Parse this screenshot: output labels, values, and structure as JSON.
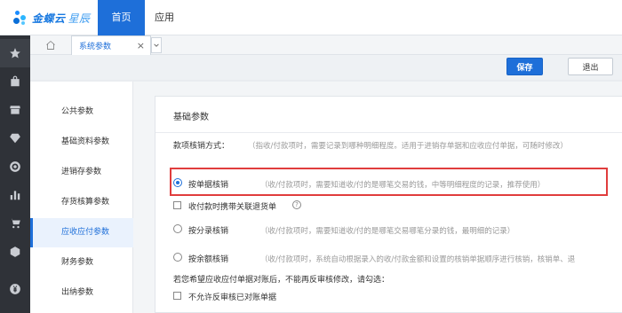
{
  "brand": {
    "name": "金蝶云",
    "product": "星辰"
  },
  "topnav": {
    "home": "首页",
    "apps": "应用"
  },
  "rail": {
    "items": [
      "star-icon",
      "bag-icon",
      "store-icon",
      "diamond-icon",
      "target-icon",
      "chart-icon",
      "cart-icon",
      "box-icon",
      "yen-icon"
    ]
  },
  "tabs": {
    "current": "系统参数",
    "close": "×"
  },
  "toolbar": {
    "save_label": "保存",
    "exit_label": "退出"
  },
  "sidebar": {
    "items": [
      {
        "label": "公共参数"
      },
      {
        "label": "基础资料参数"
      },
      {
        "label": "进销存参数"
      },
      {
        "label": "存货核算参数"
      },
      {
        "label": "应收应付参数"
      },
      {
        "label": "财务参数"
      },
      {
        "label": "出纳参数"
      }
    ],
    "active_index": 4
  },
  "panel": {
    "title": "基础参数",
    "method_label": "款项核销方式：",
    "method_hint": "（指收/付款项时，需要记录到哪种明细程度。适用于进销存单据和应收应付单据，可随时修改）",
    "options": [
      {
        "label": "按单据核销",
        "hint": "（收/付款项时，需要知道收/付的是哪笔交易的钱，中等明细程度的记录，推荐使用）",
        "selected": true
      },
      {
        "label": "按分录核销",
        "hint": "（收/付款项时，需要知道收/付的是哪笔交易哪笔分录的钱，最明细的记录）",
        "selected": false
      },
      {
        "label": "按余额核销",
        "hint": "（收/付款项时，系统自动根据录入的收/付款金额和设置的核销单据顺序进行核销，核销单、退",
        "selected": false
      }
    ],
    "checkbox_refund": {
      "label": "收付款时携带关联退货单",
      "checked": false,
      "help": "?"
    },
    "note": "若您希望应收应付单据对账后，不能再反审核修改，请勾选：",
    "checkbox_reverse": {
      "label": "不允许反审核已对账单据",
      "checked": false
    }
  }
}
